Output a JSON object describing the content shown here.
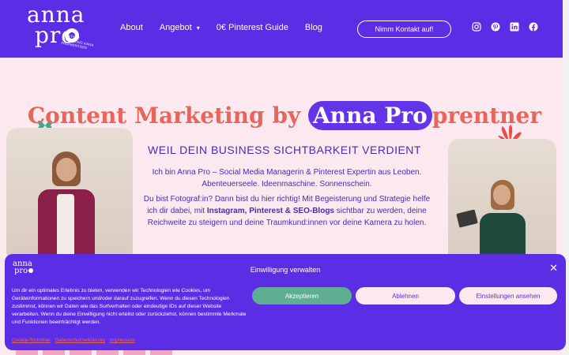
{
  "header": {
    "logo_line1": "anna",
    "logo_line2": "pro",
    "logo_tagline": "CONTENT MARKETING ANNA PROPRENTNER",
    "nav": [
      {
        "label": "About"
      },
      {
        "label": "Angebot",
        "caret": "▾"
      },
      {
        "label": "0€ Pinterest Guide"
      },
      {
        "label": "Blog"
      }
    ],
    "contact_label": "Nimm Kontakt auf!",
    "socials": [
      "instagram-icon",
      "pinterest-icon",
      "linkedin-icon",
      "facebook-icon"
    ]
  },
  "hero": {
    "title_before": "Content Marketing by ",
    "title_highlight": "Anna Pro",
    "title_after": "prentner",
    "subtitle": "WEIL DEIN BUSINESS SICHTBARKEIT VERDIENT",
    "intro_line1": "Ich bin Anna Pro – Social Media Managerin & Pinterest Expertin aus Leoben.",
    "intro_line2": "Abenteuerseele. Ideenmaschine. Sonnenschein.",
    "body_before": "Du bist Fotograf:in? Dann bist du hier richtig! Mit Begeisterung und Strategie helfe ich dir dabei, mit ",
    "body_bold": "Instagram, Pinterest & SEO-Blogs",
    "body_after": " sichtbar zu werden, deine Reichweite zu steigern und deine Traumkund:innen vor deine Kamera zu holen."
  },
  "cookie": {
    "logo_line1": "anna",
    "logo_line2": "pro",
    "title": "Einwilligung verwalten",
    "close": "✕",
    "text": "Um dir ein optimales Erlebnis zu bieten, verwenden wir Technologien wie Cookies, um Geräteinformationen zu speichern und/oder darauf zuzugreifen. Wenn du diesen Technologien zustimmst, können wir Daten wie das Surfverhalten oder eindeutige IDs auf dieser Website verarbeiten. Wenn du deine Einwilligung nicht erteilst oder zurückziehst, können bestimmte Merkmale und Funktionen beeinträchtigt werden.",
    "accept": "Akzeptieren",
    "decline": "Ablehnen",
    "settings": "Einstellungen ansehen",
    "links": [
      "Cookie-Richtlinie",
      "Datenschutzerklärung",
      "Impressum"
    ]
  },
  "colors": {
    "brand_purple": "#5b2ee5",
    "coral": "#e8655c",
    "background_pink": "#fbe9ef",
    "accept_green": "#5fae92"
  }
}
